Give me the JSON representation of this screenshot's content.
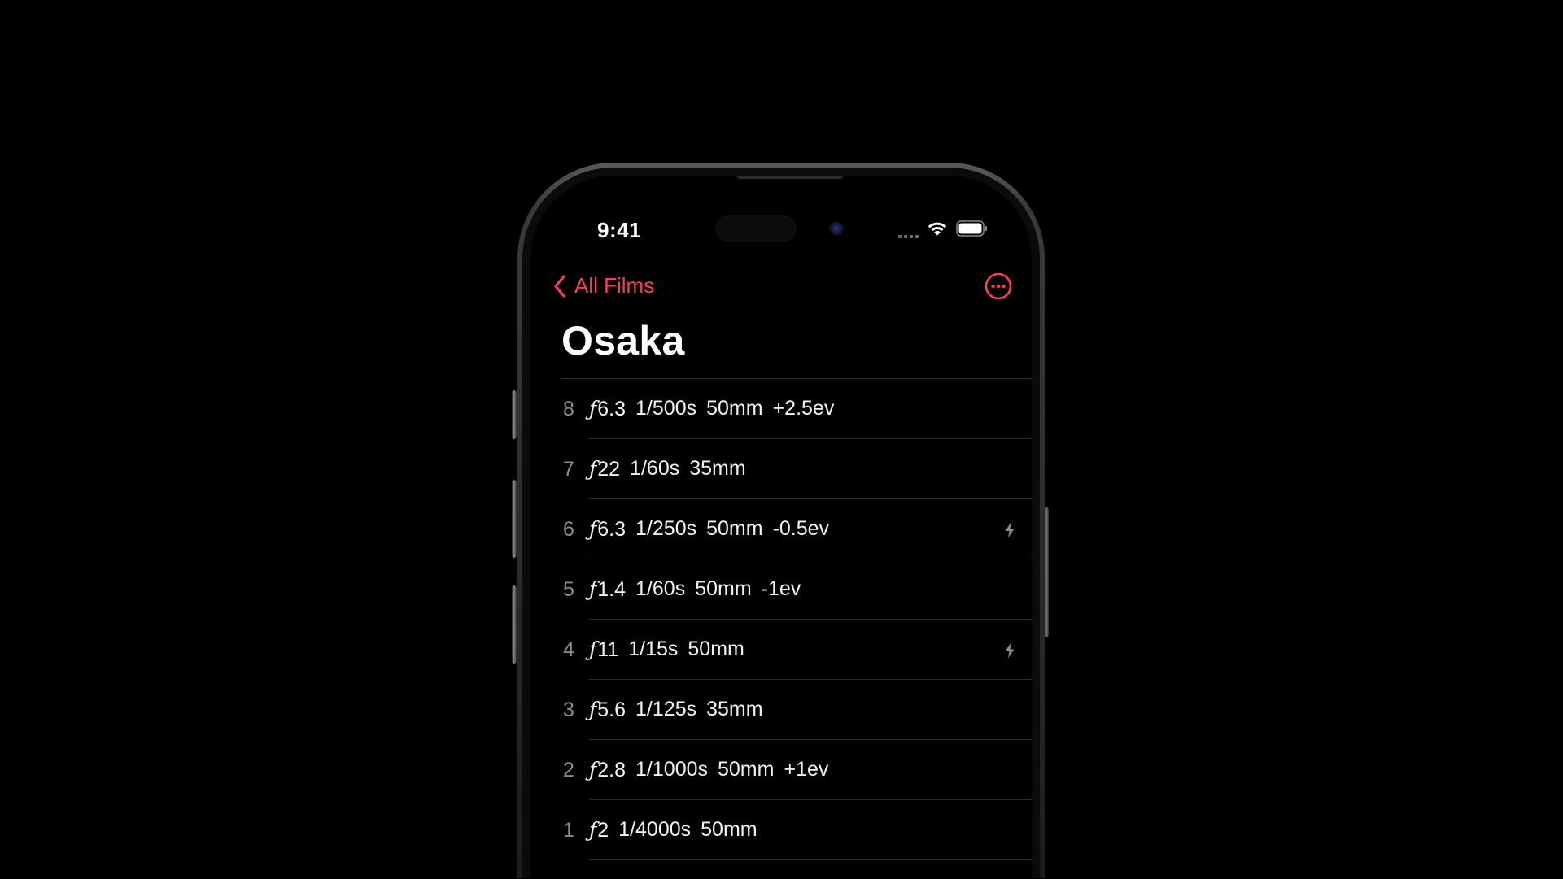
{
  "status_bar": {
    "time": "9:41"
  },
  "nav": {
    "back_label": "All Films"
  },
  "page": {
    "title": "Osaka"
  },
  "colors": {
    "accent": "#ff3b5c",
    "background": "#000000",
    "text_primary": "#f2f2f2",
    "text_secondary": "#8c8c8c"
  },
  "icons": {
    "back": "chevron-left-icon",
    "more": "ellipsis-circle-icon",
    "flash": "bolt-icon",
    "wifi": "wifi-icon",
    "battery": "battery-icon",
    "signal": "signal-dots-icon"
  },
  "shots": [
    {
      "number": "8",
      "aperture": "6.3",
      "shutter": "1/500s",
      "focal": "50mm",
      "ev": "+2.5ev",
      "flash": false
    },
    {
      "number": "7",
      "aperture": "22",
      "shutter": "1/60s",
      "focal": "35mm",
      "ev": "",
      "flash": false
    },
    {
      "number": "6",
      "aperture": "6.3",
      "shutter": "1/250s",
      "focal": "50mm",
      "ev": "-0.5ev",
      "flash": true
    },
    {
      "number": "5",
      "aperture": "1.4",
      "shutter": "1/60s",
      "focal": "50mm",
      "ev": "-1ev",
      "flash": false
    },
    {
      "number": "4",
      "aperture": "11",
      "shutter": "1/15s",
      "focal": "50mm",
      "ev": "",
      "flash": true
    },
    {
      "number": "3",
      "aperture": "5.6",
      "shutter": "1/125s",
      "focal": "35mm",
      "ev": "",
      "flash": false
    },
    {
      "number": "2",
      "aperture": "2.8",
      "shutter": "1/1000s",
      "focal": "50mm",
      "ev": "+1ev",
      "flash": false
    },
    {
      "number": "1",
      "aperture": "2",
      "shutter": "1/4000s",
      "focal": "50mm",
      "ev": "",
      "flash": false
    }
  ]
}
